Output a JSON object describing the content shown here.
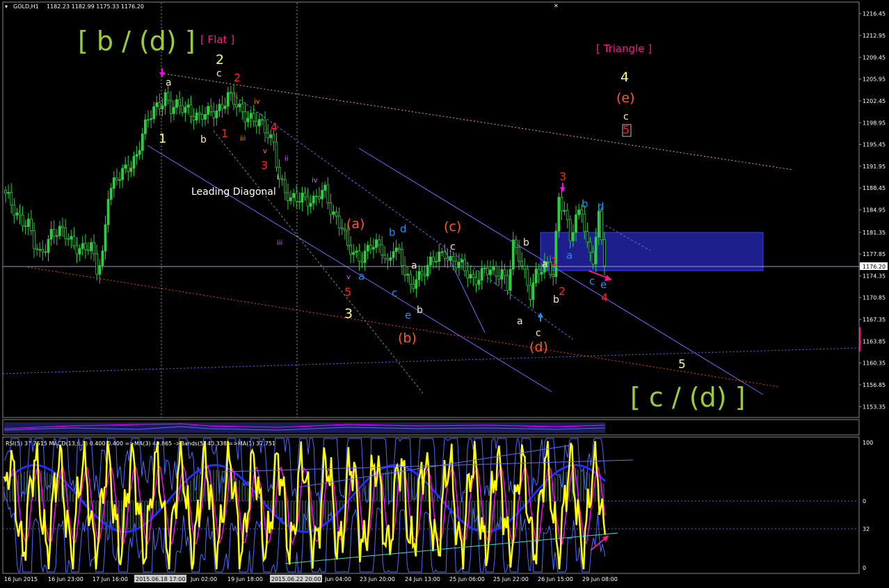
{
  "header": {
    "symbol": "GOLD,H1",
    "ohlc": "1182.23 1182.99 1175.33 1176.20"
  },
  "indicator_header": "RSI(5) 37.7515  MACD(13,6,1) 0.400 0.400  =>MA(3) 49.865  ->Bands(5) 40.338  =>MA(1) 37.751",
  "colors": {
    "background": "#000000",
    "bull_candle": "#2ecc40",
    "bear_candle": "#2ecc40",
    "grid": "#7f7f7f",
    "price_line": "#a0a0c0",
    "rsi_line": "#ffff00",
    "rsi_ma": "#ff00ff",
    "bands": "#4a6cff",
    "macd_hist": "#2f4f4f",
    "zone": "#1e1e8c"
  },
  "chart_data": [
    {
      "type": "candlestick",
      "title": "GOLD,H1",
      "y_axis_ticks": [
        "1216.45",
        "1212.95",
        "1209.45",
        "1205.95",
        "1202.45",
        "1198.95",
        "1195.45",
        "1191.95",
        "1188.45",
        "1184.95",
        "1181.35",
        "1177.85",
        "1174.35",
        "1170.85",
        "1167.35",
        "1163.85",
        "1160.35",
        "1156.85",
        "1153.35"
      ],
      "ylim": [
        1151.6,
        1218.2
      ],
      "current_price": "1176.20",
      "x_axis_ticks": [
        "16 Jun 2015",
        "16 Jun 23:00",
        "17 Jun 16:00",
        "2015.06.18 17:00",
        "Jun 02:00",
        "19 Jun 18:00",
        "2015.06.22 20:00",
        "Jun 04:00",
        "23 Jun 20:00",
        "24 Jun 13:00",
        "25 Jun 06:00",
        "25 Jun 22:00",
        "26 Jun 15:00",
        "29 Jun 08:00"
      ],
      "close_path": [
        [
          0,
          1187.0
        ],
        [
          4,
          1184.5
        ],
        [
          8,
          1182.5
        ],
        [
          10,
          1179.0
        ],
        [
          12,
          1177.5
        ],
        [
          16,
          1181.5
        ],
        [
          20,
          1181.0
        ],
        [
          26,
          1179.0
        ],
        [
          30,
          1178.5
        ],
        [
          32,
          1175.2
        ],
        [
          34,
          1178.0
        ],
        [
          36,
          1188.0
        ],
        [
          40,
          1190.0
        ],
        [
          46,
          1194.0
        ],
        [
          48,
          1197.0
        ],
        [
          52,
          1201.0
        ],
        [
          56,
          1203.5
        ],
        [
          58,
          1201.0
        ],
        [
          64,
          1201.5
        ],
        [
          68,
          1199.5
        ],
        [
          72,
          1200.5
        ],
        [
          76,
          1202.0
        ],
        [
          78,
          1203.0
        ],
        [
          82,
          1201.0
        ],
        [
          86,
          1200.0
        ],
        [
          90,
          1198.0
        ],
        [
          94,
          1196.0
        ],
        [
          96,
          1190.5
        ],
        [
          98,
          1187.5
        ],
        [
          100,
          1186.0
        ],
        [
          104,
          1187.5
        ],
        [
          108,
          1186.0
        ],
        [
          112,
          1188.0
        ],
        [
          114,
          1185.5
        ],
        [
          118,
          1182.0
        ],
        [
          120,
          1178.5
        ],
        [
          124,
          1177.5
        ],
        [
          128,
          1179.0
        ],
        [
          132,
          1178.5
        ],
        [
          134,
          1176.5
        ],
        [
          136,
          1179.5
        ],
        [
          138,
          1177.5
        ],
        [
          140,
          1174.5
        ],
        [
          142,
          1172.5
        ],
        [
          144,
          1174.5
        ],
        [
          148,
          1175.5
        ],
        [
          152,
          1177.5
        ],
        [
          154,
          1178.5
        ],
        [
          156,
          1177.0
        ],
        [
          160,
          1175.5
        ],
        [
          164,
          1174.0
        ],
        [
          168,
          1175.0
        ],
        [
          172,
          1174.5
        ],
        [
          174,
          1175.5
        ],
        [
          176,
          1173.0
        ],
        [
          178,
          1179.0
        ],
        [
          180,
          1177.0
        ],
        [
          182,
          1174.5
        ],
        [
          184,
          1172.0
        ],
        [
          186,
          1175.0
        ],
        [
          190,
          1175.5
        ],
        [
          192,
          1174.5
        ],
        [
          194,
          1187.5
        ],
        [
          196,
          1185.0
        ],
        [
          198,
          1180.0
        ],
        [
          200,
          1183.0
        ],
        [
          202,
          1185.0
        ],
        [
          204,
          1179.5
        ],
        [
          206,
          1177.5
        ],
        [
          208,
          1183.5
        ],
        [
          210,
          1176.2
        ]
      ],
      "swing_labels": [
        {
          "text": "[ b / (d) ]",
          "color": "#9acd32"
        },
        {
          "text": "[ Flat ]",
          "color": "#ff1493"
        },
        {
          "text": "[ Triangle ]",
          "color": "#ff1493"
        },
        {
          "text": "[ c / (d) ]",
          "color": "#9acd32"
        },
        {
          "text": "Leading Diagonal",
          "color": "#ffffff"
        },
        {
          "text": "1",
          "color": "#ffff66"
        },
        {
          "text": "2",
          "color": "#ffff66"
        },
        {
          "text": "3",
          "color": "#ffff66"
        },
        {
          "text": "4",
          "color": "#ffff66"
        },
        {
          "text": "5",
          "color": "#ffff66"
        },
        {
          "text": "1",
          "color": "#ff2020"
        },
        {
          "text": "2",
          "color": "#ff2020"
        },
        {
          "text": "3",
          "color": "#ff2020"
        },
        {
          "text": "4",
          "color": "#ff2020"
        },
        {
          "text": "5",
          "color": "#ff2020"
        },
        {
          "text": "1",
          "color": "#ff2020"
        },
        {
          "text": "2",
          "color": "#ff2020"
        },
        {
          "text": "3",
          "color": "#ff2020"
        },
        {
          "text": "4",
          "color": "#ff2020"
        },
        {
          "text": "5",
          "color": "#ff2020"
        },
        {
          "text": "(a)",
          "color": "#ff5a1f"
        },
        {
          "text": "(b)",
          "color": "#ff5a1f"
        },
        {
          "text": "(c)",
          "color": "#ff5a1f"
        },
        {
          "text": "(d)",
          "color": "#ff5a1f"
        },
        {
          "text": "(e)",
          "color": "#ff5a1f"
        },
        {
          "text": "a",
          "color": "#ffe4b5"
        },
        {
          "text": "b",
          "color": "#ffe4b5"
        },
        {
          "text": "c",
          "color": "#ffe4b5"
        },
        {
          "text": "a",
          "color": "#ffe4b5"
        },
        {
          "text": "b",
          "color": "#ffe4b5"
        },
        {
          "text": "c",
          "color": "#ffe4b5"
        },
        {
          "text": "a",
          "color": "#ffe4b5"
        },
        {
          "text": "b",
          "color": "#ffe4b5"
        },
        {
          "text": "c",
          "color": "#ffe4b5"
        },
        {
          "text": "a",
          "color": "#1e90ff"
        },
        {
          "text": "b",
          "color": "#1e90ff"
        },
        {
          "text": "c",
          "color": "#1e90ff"
        },
        {
          "text": "d",
          "color": "#1e90ff"
        },
        {
          "text": "e",
          "color": "#1e90ff"
        },
        {
          "text": "a",
          "color": "#1e90ff"
        },
        {
          "text": "b",
          "color": "#1e90ff"
        },
        {
          "text": "c",
          "color": "#1e90ff"
        },
        {
          "text": "d",
          "color": "#1e90ff"
        },
        {
          "text": "e",
          "color": "#1e90ff"
        },
        {
          "text": "a",
          "color": "#ffe4b5"
        },
        {
          "text": "b",
          "color": "#ffe4b5"
        },
        {
          "text": "c",
          "color": "#ffe4b5"
        },
        {
          "text": "ii",
          "color": "#cc66ff"
        },
        {
          "text": "iii",
          "color": "#cc66ff"
        },
        {
          "text": "iv",
          "color": "#cc66ff"
        },
        {
          "text": "v",
          "color": "#cc66ff"
        },
        {
          "text": "i",
          "color": "#ffffff"
        },
        {
          "text": "ii",
          "color": "#ff8c00"
        },
        {
          "text": "iii",
          "color": "#ff8c00"
        },
        {
          "text": "iv",
          "color": "#ff8c00"
        },
        {
          "text": "v",
          "color": "#ff8c00"
        }
      ]
    },
    {
      "type": "line",
      "title": "RSI(5) / MACD(13,6,1)",
      "y_axis_ticks": [
        "100",
        "0",
        "32",
        "0"
      ],
      "series": [
        {
          "name": "RSI(5)",
          "color": "#ffff00"
        },
        {
          "name": "MA(3)",
          "color": "#ff00ff"
        },
        {
          "name": "Bands(5)",
          "color": "#4a6cff"
        }
      ]
    }
  ]
}
